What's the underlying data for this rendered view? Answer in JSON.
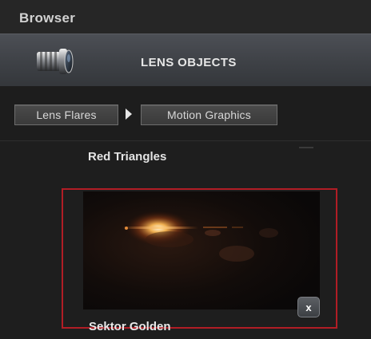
{
  "header": {
    "title": "Browser"
  },
  "category": {
    "title": "LENS OBJECTS",
    "icon": "camera-lens-icon"
  },
  "breadcrumb": {
    "items": [
      "Lens Flares",
      "Motion Graphics"
    ],
    "separator_icon": "chevron-right-icon"
  },
  "content": {
    "items": [
      {
        "label": "Red Triangles"
      },
      {
        "label": "Sektor Golden",
        "selected": true,
        "close_label": "x",
        "preview": "lens-flare-thumbnail"
      }
    ]
  },
  "colors": {
    "selection_border": "#b11d25",
    "background": "#1e1e1e",
    "header": "#262626"
  }
}
